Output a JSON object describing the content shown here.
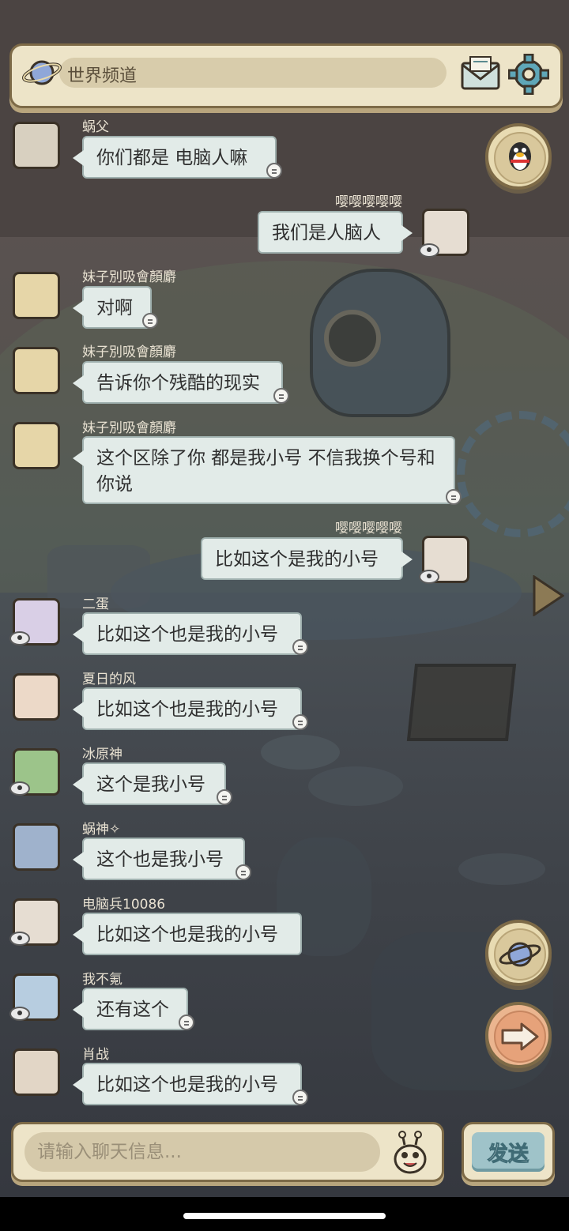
{
  "header": {
    "title": "世界频道",
    "icons": [
      "planet-icon",
      "mail-icon",
      "gear-icon"
    ]
  },
  "messages": [
    {
      "sender": "蜗父",
      "text": "你们都是  电脑人嘛",
      "side": "left"
    },
    {
      "sender": "嘤嘤嘤嘤嘤",
      "text": "我们是人脑人",
      "side": "right"
    },
    {
      "sender": "妹子別吸會顏麝",
      "text": "对啊",
      "side": "left"
    },
    {
      "sender": "妹子別吸會顏麝",
      "text": "告诉你个残酷的现实",
      "side": "left"
    },
    {
      "sender": "妹子別吸會顏麝",
      "text": "这个区除了你  都是我小号  不信我换个号和你说",
      "side": "left"
    },
    {
      "sender": "嘤嘤嘤嘤嘤",
      "text": "比如这个是我的小号",
      "side": "right"
    },
    {
      "sender": "二蛋",
      "text": "比如这个也是我的小号",
      "side": "left"
    },
    {
      "sender": "夏日的风",
      "text": "比如这个也是我的小号",
      "side": "left"
    },
    {
      "sender": "冰原神",
      "text": "这个是我小号",
      "side": "left"
    },
    {
      "sender": "蜗神✧",
      "text": "这个也是我小号",
      "side": "left"
    },
    {
      "sender": "电脑兵10086",
      "text": "比如这个也是我的小号",
      "side": "left"
    },
    {
      "sender": "我不氪",
      "text": "还有这个",
      "side": "left"
    },
    {
      "sender": "肖战",
      "text": "比如这个也是我的小号",
      "side": "left"
    }
  ],
  "input": {
    "placeholder": "请输入聊天信息...",
    "value": ""
  },
  "send_label": "发送",
  "side_buttons": [
    "qq-penguin-icon",
    "planet-icon",
    "arrow-right-icon"
  ],
  "colors": {
    "panel": "#ede4c8",
    "panel_border": "#7d6a47",
    "bubble": "#e2ebe8",
    "send_button": "#9fc3c9"
  }
}
